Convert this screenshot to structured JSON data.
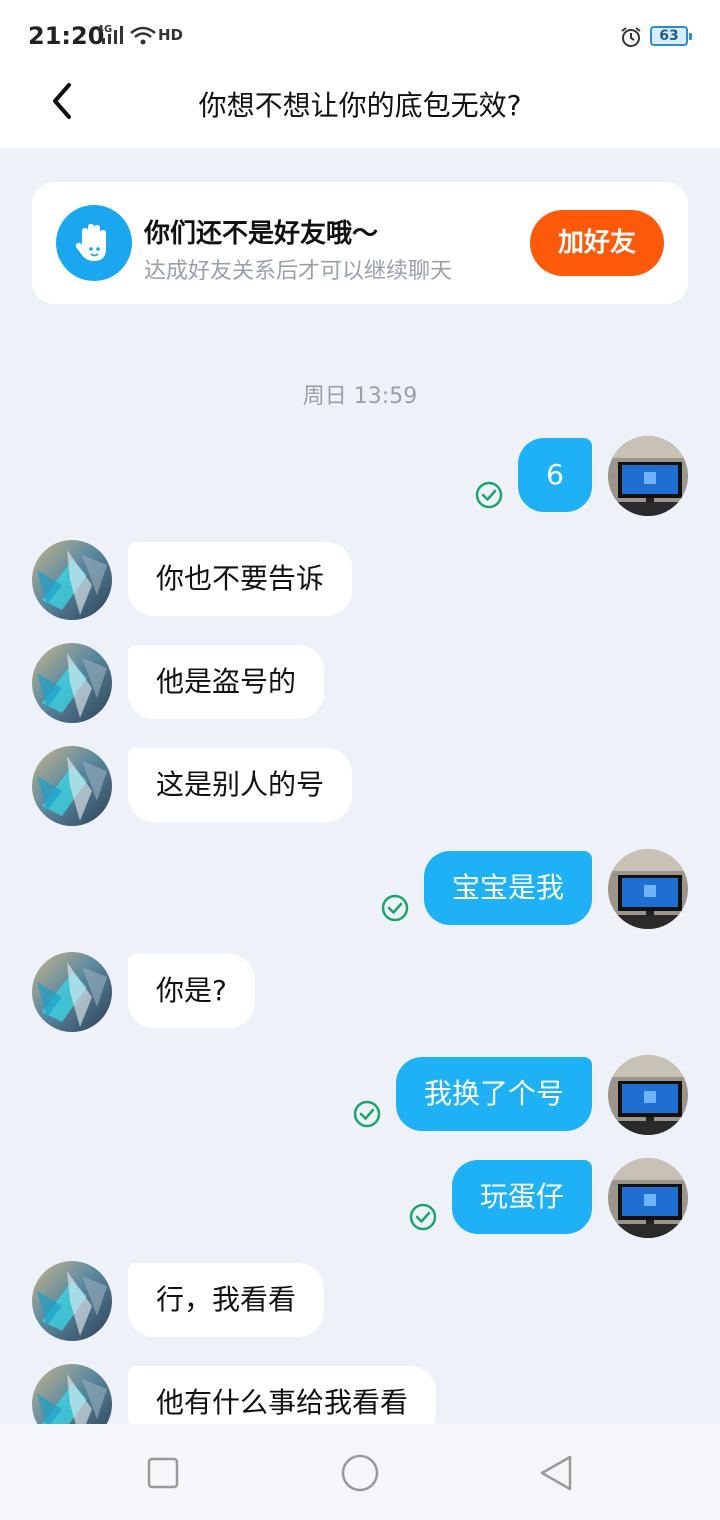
{
  "status_bar": {
    "time": "21:20",
    "network": "4G",
    "hd": "HD",
    "battery": "63"
  },
  "header": {
    "title": "你想不想让你的底包无效?"
  },
  "friend_notice": {
    "title": "你们还不是好友哦～",
    "subtitle": "达成好友关系后才可以继续聊天",
    "button_label": "加好友"
  },
  "timestamp": "周日 13:59",
  "messages": [
    {
      "side": "out",
      "text": "6"
    },
    {
      "side": "in",
      "text": "你也不要告诉"
    },
    {
      "side": "in",
      "text": "他是盗号的"
    },
    {
      "side": "in",
      "text": "这是别人的号"
    },
    {
      "side": "out",
      "text": "宝宝是我"
    },
    {
      "side": "in",
      "text": "你是?"
    },
    {
      "side": "out",
      "text": "我换了个号"
    },
    {
      "side": "out",
      "text": "玩蛋仔"
    },
    {
      "side": "in",
      "text": "行，我看看"
    },
    {
      "side": "in",
      "text": "他有什么事给我看看"
    }
  ],
  "colors": {
    "accent_blue": "#1eb1f5",
    "add_friend_orange": "#ff5a0a",
    "read_check_green": "#1aa56a"
  },
  "icons": {
    "back": "chevron-left-icon",
    "notice": "waving-hand-icon",
    "read": "check-circle-icon",
    "nav_recent": "square-icon",
    "nav_home": "circle-icon",
    "nav_back": "triangle-back-icon"
  }
}
